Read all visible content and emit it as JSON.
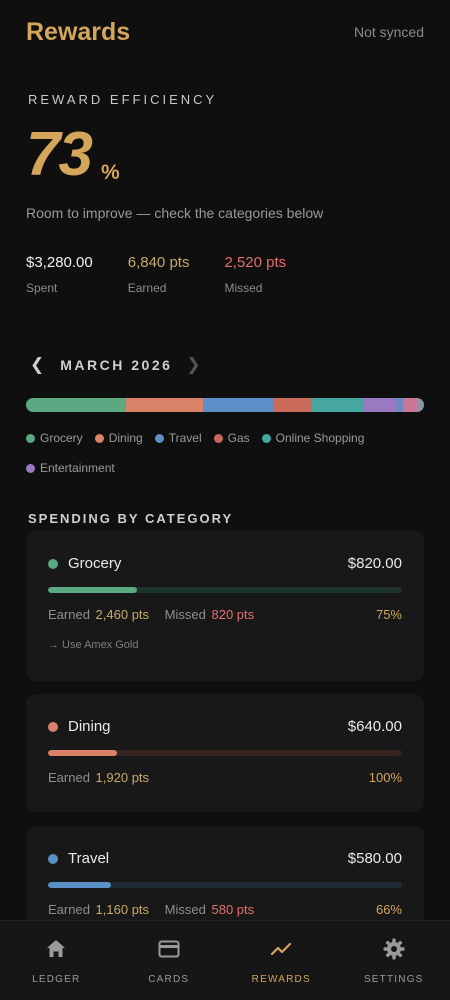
{
  "header": {
    "title": "Rewards",
    "sync_status": "Not synced"
  },
  "efficiency": {
    "label": "REWARD EFFICIENCY",
    "value": "73",
    "unit": "%",
    "hint": "Room to improve — check the categories below"
  },
  "stats": [
    {
      "value": "$3,280.00",
      "label": "Spent",
      "color": "#f0f0f0"
    },
    {
      "value": "6,840 pts",
      "label": "Earned",
      "color": "#c9a86a"
    },
    {
      "value": "2,520 pts",
      "label": "Missed",
      "color": "#e46f6f"
    }
  ],
  "month_nav": {
    "prev_icon": "chevron-left-icon",
    "label": "MARCH 2026",
    "next_icon": "chevron-right-icon"
  },
  "spend_breakdown": [
    {
      "name": "Grocery",
      "share": 0.25,
      "color": "#5aa982"
    },
    {
      "name": "Dining",
      "share": 0.195,
      "color": "#d98268"
    },
    {
      "name": "Travel",
      "share": 0.177,
      "color": "#5b8fc7"
    },
    {
      "name": "Gas",
      "share": 0.095,
      "color": "#c96a5b"
    },
    {
      "name": "Online Shopping",
      "share": 0.13,
      "color": "#46a6a0"
    },
    {
      "name": "Entertainment",
      "share": 0.08,
      "color": "#9a78c2"
    },
    {
      "name": "",
      "share": 0.02,
      "color": "#7088c0"
    },
    {
      "name": "",
      "share": 0.035,
      "color": "#c97896"
    },
    {
      "name": "",
      "share": 0.018,
      "color": "#8a96a6"
    }
  ],
  "legend": [
    {
      "label": "Grocery",
      "color": "#5aa982"
    },
    {
      "label": "Dining",
      "color": "#d98268"
    },
    {
      "label": "Travel",
      "color": "#5b8fc7"
    },
    {
      "label": "Gas",
      "color": "#c96a5b"
    },
    {
      "label": "Online Shopping",
      "color": "#46a6a0"
    },
    {
      "label": "Entertainment",
      "color": "#9a78c2"
    }
  ],
  "section_title": "SPENDING BY CATEGORY",
  "categories": [
    {
      "name": "Grocery",
      "amount": "$820.00",
      "color": "#5aa982",
      "track": "#1e3329",
      "progress": 0.75,
      "earned_label": "Earned",
      "earned": "2,460 pts",
      "missed_label": "Missed",
      "missed": "820 pts",
      "pct": "75%",
      "tip": "→ Use Amex Gold"
    },
    {
      "name": "Dining",
      "amount": "$640.00",
      "color": "#d98268",
      "track": "#35241f",
      "progress": 1.0,
      "earned_label": "Earned",
      "earned": "1,920 pts",
      "pct": "100%"
    },
    {
      "name": "Travel",
      "amount": "$580.00",
      "color": "#5b8fc7",
      "track": "#1f2a36",
      "progress": 0.66,
      "earned_label": "Earned",
      "earned": "1,160 pts",
      "missed_label": "Missed",
      "missed": "580 pts",
      "pct": "66%"
    }
  ],
  "bottom_nav": [
    {
      "label": "LEDGER",
      "icon": "home-icon",
      "active": false
    },
    {
      "label": "CARDS",
      "icon": "card-icon",
      "active": false
    },
    {
      "label": "REWARDS",
      "icon": "trend-icon",
      "active": true
    },
    {
      "label": "SETTINGS",
      "icon": "gear-icon",
      "active": false
    }
  ],
  "colors": {
    "accent": "#d4a55a",
    "background": "#0f0f0f",
    "card": "#181818",
    "missed": "#e46f6f"
  }
}
